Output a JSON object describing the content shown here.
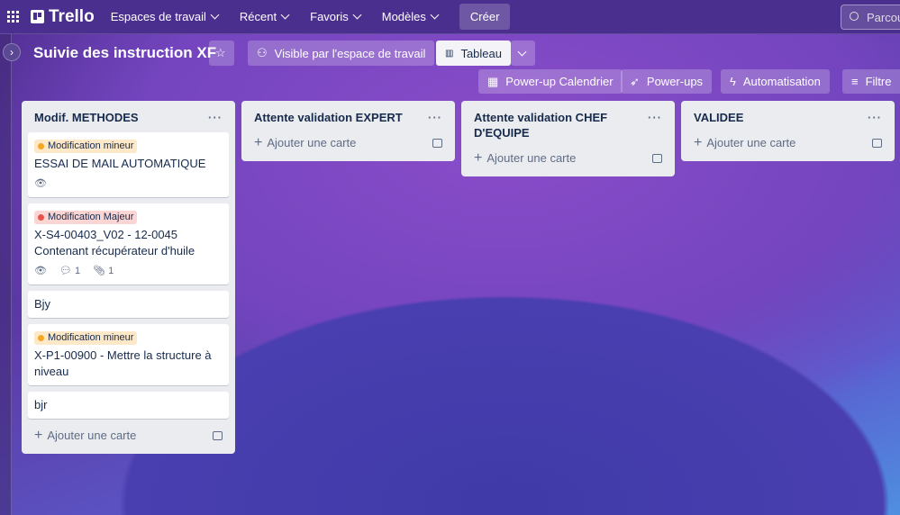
{
  "topbar": {
    "brand": "Trello",
    "nav": [
      "Espaces de travail",
      "Récent",
      "Favoris",
      "Modèles"
    ],
    "create": "Créer",
    "search_placeholder": "Parcourir"
  },
  "board": {
    "title": "Suivie des instruction XF",
    "visibility": "Visible par l'espace de travail",
    "view": "Tableau",
    "buttons": [
      "Power-up Calendrier",
      "Power-ups",
      "Automatisation",
      "Filtre"
    ]
  },
  "lists": [
    {
      "title": "Modif. METHODES",
      "cards": [
        {
          "label": "Modification mineur",
          "label_color": "#f5a623",
          "title": "ESSAI DE MAIL AUTOMATIQUE",
          "watch": true
        },
        {
          "label": "Modification Majeur",
          "label_color": "#e5534b",
          "title": "X-S4-00403_V02 - 12-0045 Contenant récupérateur d'huile",
          "watch": true,
          "comments": "1",
          "attachments": "1"
        },
        {
          "title": "Bjy"
        },
        {
          "label": "Modification mineur",
          "label_color": "#f5a623",
          "title": "X-P1-00900 - Mettre la structure à niveau"
        },
        {
          "title": "bjr"
        }
      ]
    },
    {
      "title": "Attente validation EXPERT",
      "cards": []
    },
    {
      "title": "Attente validation CHEF D'EQUIPE",
      "cards": []
    },
    {
      "title": "VALIDEE",
      "cards": []
    }
  ],
  "add_card": "Ajouter une carte"
}
